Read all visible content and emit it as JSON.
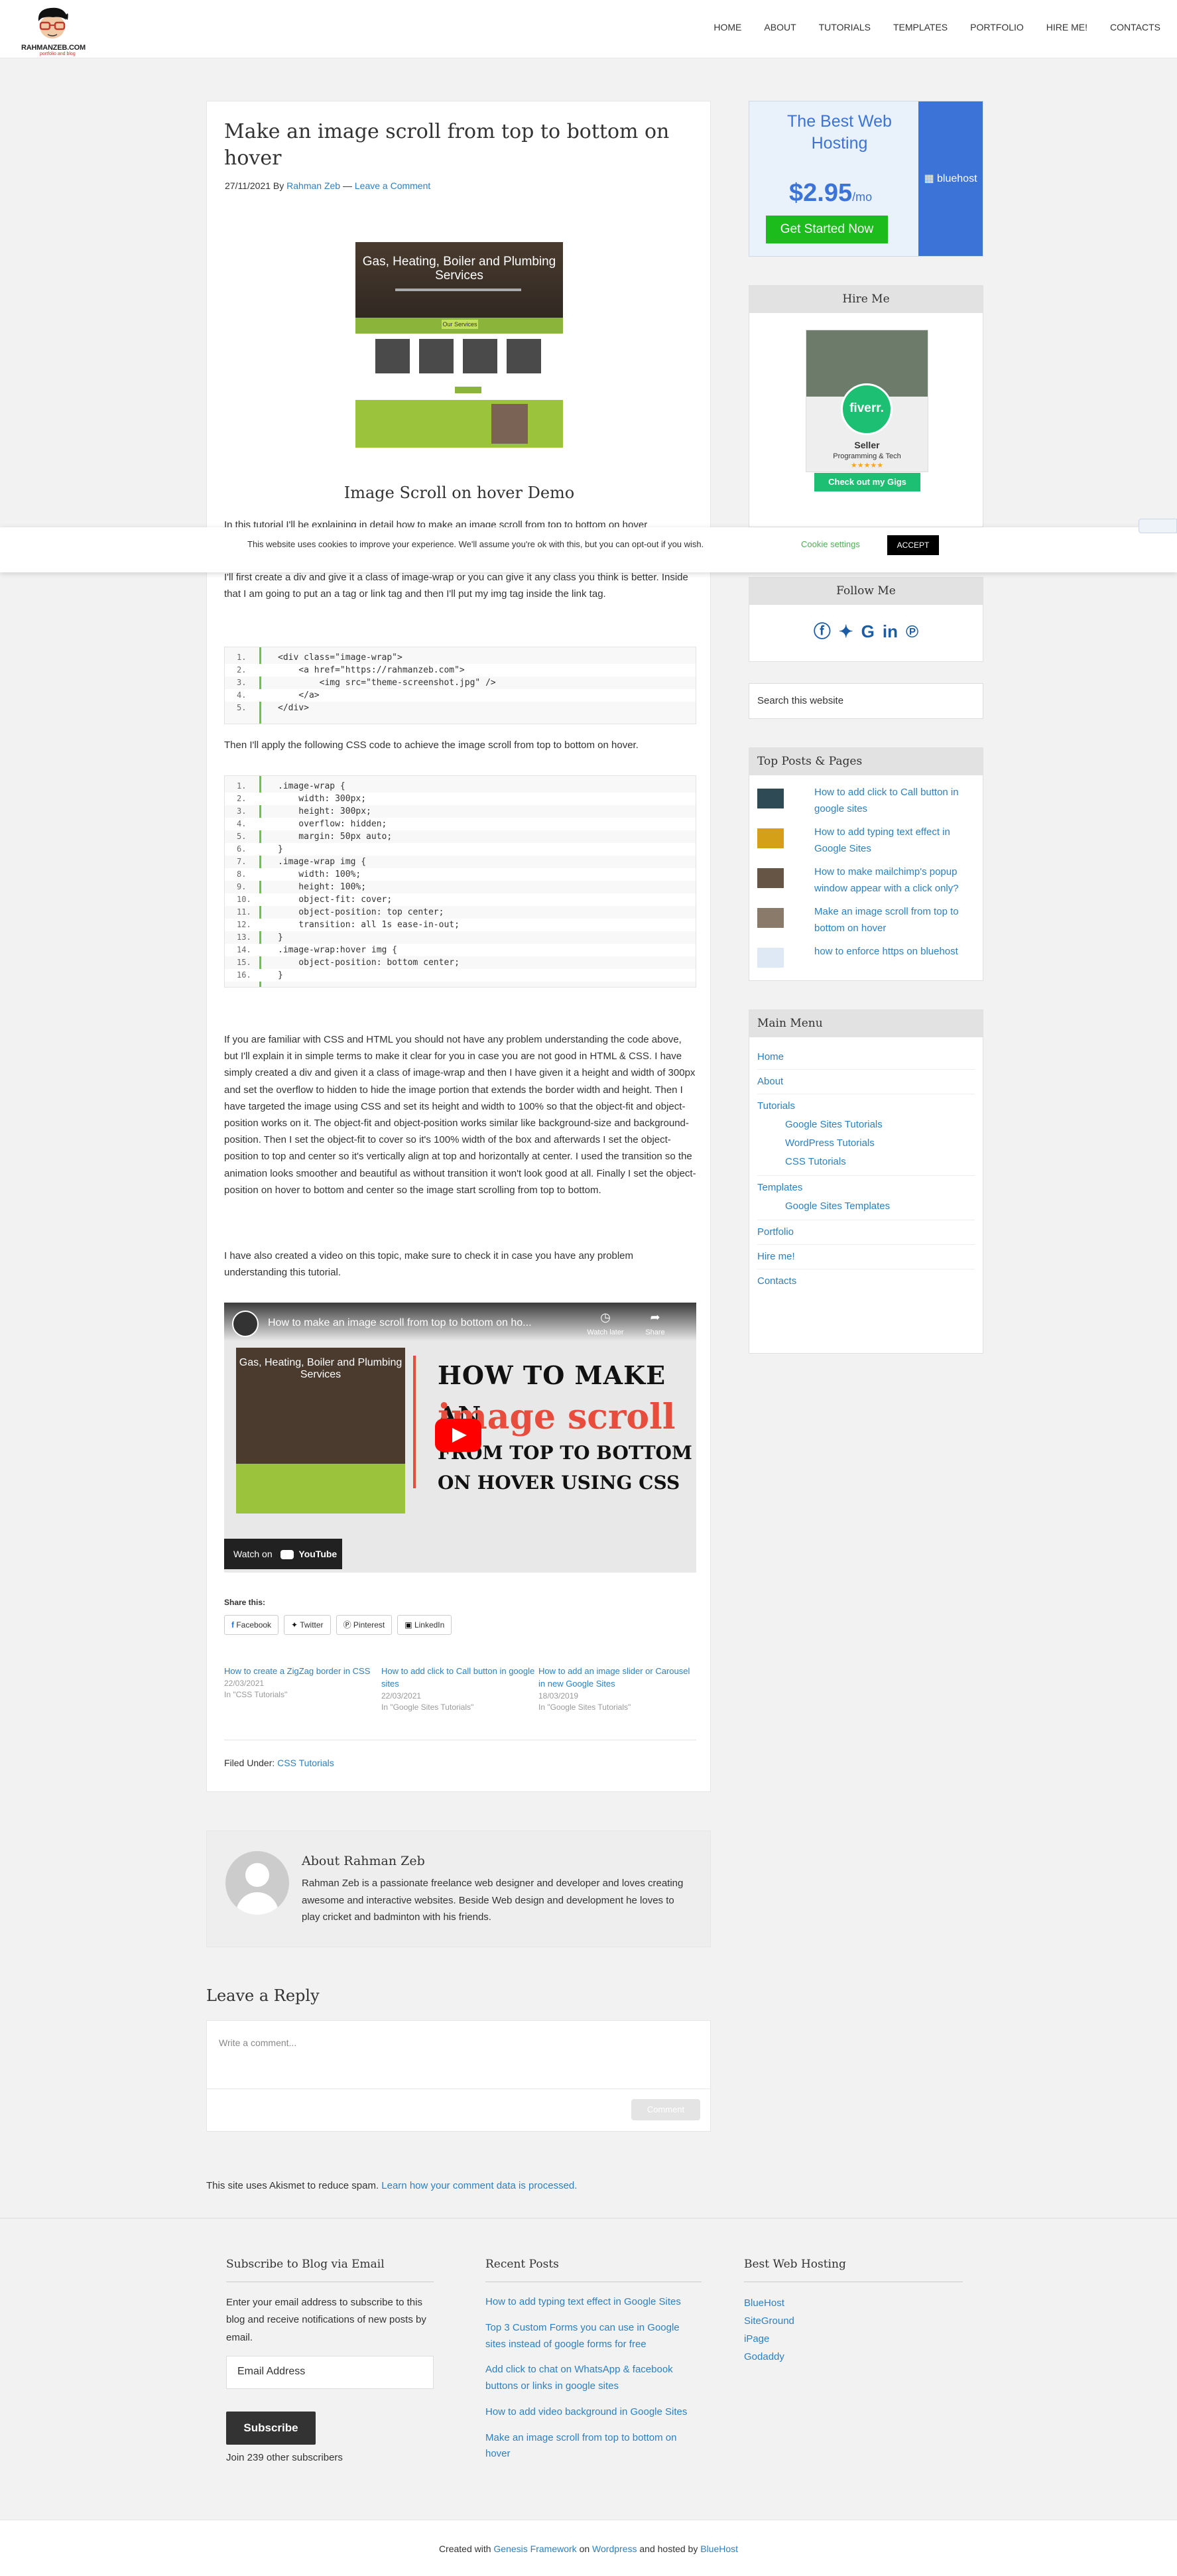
{
  "header": {
    "logo_text": "RAHMANZEB.COM",
    "logo_sub": "portfolio and blog",
    "nav": [
      "HOME",
      "ABOUT",
      "TUTORIALS",
      "TEMPLATES",
      "PORTFOLIO",
      "HIRE ME!",
      "CONTACTS"
    ]
  },
  "article": {
    "title": "Make an image scroll from top to bottom on hover",
    "date": "27/11/2021",
    "by": "By",
    "author": "Rahman Zeb",
    "dash": "—",
    "comment_link": "Leave a Comment",
    "thumb_title": "Gas, Heating, Boiler and Plumbing Services",
    "thumb_btn": "Our Services",
    "demo_title": "Image Scroll on hover Demo",
    "intro": "In this tutorial I'll be explaining in detail how to make an image scroll from top to bottom on hover",
    "p1": "I'll first create a div and give it a class of image-wrap or you can give it any class you think is better. Inside that I am going to put an a tag or link tag and then I'll put my img tag inside the link tag.",
    "code1": [
      {
        "n": "1.",
        "c": "<div class=\"image-wrap\">"
      },
      {
        "n": "2.",
        "c": "    <a href=\"https://rahmanzeb.com\">"
      },
      {
        "n": "3.",
        "c": "        <img src=\"theme-screenshot.jpg\" />"
      },
      {
        "n": "4.",
        "c": "    </a>"
      },
      {
        "n": "5.",
        "c": "</div>"
      }
    ],
    "p2": "Then I'll apply the following CSS code to achieve the image scroll from top to bottom on hover.",
    "code2": [
      {
        "n": "1.",
        "c": ".image-wrap {"
      },
      {
        "n": "2.",
        "c": "    width: 300px;"
      },
      {
        "n": "3.",
        "c": "    height: 300px;"
      },
      {
        "n": "4.",
        "c": "    overflow: hidden;"
      },
      {
        "n": "5.",
        "c": "    margin: 50px auto;"
      },
      {
        "n": "6.",
        "c": "}"
      },
      {
        "n": "7.",
        "c": ".image-wrap img {"
      },
      {
        "n": "8.",
        "c": "    width: 100%;"
      },
      {
        "n": "9.",
        "c": "    height: 100%;"
      },
      {
        "n": "10.",
        "c": "    object-fit: cover;"
      },
      {
        "n": "11.",
        "c": "    object-position: top center;"
      },
      {
        "n": "12.",
        "c": "    transition: all 1s ease-in-out;"
      },
      {
        "n": "13.",
        "c": "}"
      },
      {
        "n": "14.",
        "c": ".image-wrap:hover img {"
      },
      {
        "n": "15.",
        "c": "    object-position: bottom center;"
      },
      {
        "n": "16.",
        "c": "}"
      }
    ],
    "p3": "If you are familiar with CSS and HTML you should not have any problem understanding the code above, but I'll explain it in simple terms to make it clear for you in case you are not good in HTML & CSS. I have simply created a div and given it a class of image-wrap and then I have given it a height and width of 300px and set the overflow to hidden to hide the image portion that extends the border width and height. Then I have targeted the image using CSS and set its height and width to 100% so that the object-fit and object-position works on it. The object-fit and object-position works similar like background-size and background-position. Then I set the object-fit to cover so it's 100% width of the box and afterwards I set the object-position to top and center so it's vertically align at top and horizontally at center. I used the transition so the animation looks smoother and beautiful as without transition it won't look good at all. Finally I set the object-position on hover to bottom and center so the image start scrolling from top to bottom.",
    "p4": "I have also created a video on this topic, make sure to check it in case you have any problem understanding this tutorial.",
    "video": {
      "title": "How to make an image scroll from top to bottom on ho...",
      "watch_later": "Watch later",
      "share": "Share",
      "line1": "HOW TO MAKE AN",
      "line2": "image scroll",
      "line3": "FROM TOP TO BOTTOM",
      "line4": "ON HOVER USING CSS",
      "img_title": "Gas, Heating, Boiler and Plumbing Services",
      "watch_on": "Watch on",
      "yt": "YouTube"
    },
    "share_label": "Share this:",
    "share_buttons": [
      "Facebook",
      "Twitter",
      "Pinterest",
      "LinkedIn"
    ],
    "related": [
      {
        "title": "How to create a ZigZag border in CSS",
        "date": "22/03/2021",
        "cat": "In \"CSS Tutorials\""
      },
      {
        "title": "How to add click to Call button in google sites",
        "date": "22/03/2021",
        "cat": "In \"Google Sites Tutorials\""
      },
      {
        "title": "How to add an image slider or Carousel in new Google Sites",
        "date": "18/03/2019",
        "cat": "In \"Google Sites Tutorials\""
      }
    ],
    "filed_label": "Filed Under:",
    "filed_cat": "CSS Tutorials"
  },
  "author_box": {
    "title": "About Rahman Zeb",
    "desc": "Rahman Zeb is a passionate freelance web designer and developer and loves creating awesome and interactive websites. Beside Web design and development he loves to play cricket and badminton with his friends."
  },
  "reply": {
    "heading": "Leave a Reply",
    "placeholder": "Write a comment...",
    "button": "Comment"
  },
  "akismet": {
    "text": "This site uses Akismet to reduce spam.",
    "link": "Learn how your comment data is processed."
  },
  "sidebar": {
    "ad": {
      "headline": "The Best Web Hosting",
      "price": "$2.95",
      "per": "/mo",
      "button": "Get Started Now",
      "brand": "bluehost"
    },
    "hire": {
      "title": "Hire Me",
      "badge": "fiverr.",
      "seller": "Seller",
      "prog": "Programming & Tech",
      "stars": "★★★★★",
      "gigs": "Check out my Gigs"
    },
    "follow": {
      "title": "Follow Me",
      "icons": [
        "facebook-icon",
        "twitter-icon",
        "google-icon",
        "linkedin-icon",
        "pinterest-icon"
      ]
    },
    "search_placeholder": "Search this website",
    "top_posts": {
      "title": "Top Posts & Pages",
      "items": [
        "How to add click to Call button in google sites",
        "How to add typing text effect in Google Sites",
        "How to make mailchimp's popup window appear with a click only?",
        "Make an image scroll from top to bottom on hover",
        "how to enforce https on bluehost"
      ]
    },
    "menu": {
      "title": "Main Menu",
      "home": "Home",
      "about": "About",
      "tutorials": "Tutorials",
      "tut_sub": [
        "Google Sites Tutorials",
        "WordPress Tutorials",
        "CSS Tutorials"
      ],
      "templates": "Templates",
      "tmpl_sub": [
        "Google Sites Templates"
      ],
      "portfolio": "Portfolio",
      "hire": "Hire me!",
      "contacts": "Contacts"
    }
  },
  "cookie": {
    "text": "This website uses cookies to improve your experience. We'll assume you're ok with this, but you can opt-out if you wish.",
    "settings": "Cookie settings",
    "accept": "ACCEPT"
  },
  "footer": {
    "subscribe": {
      "title": "Subscribe to Blog via Email",
      "desc": "Enter your email address to subscribe to this blog and receive notifications of new posts by email.",
      "email_placeholder": "Email Address",
      "button": "Subscribe",
      "count": "Join 239 other subscribers"
    },
    "recent": {
      "title": "Recent Posts",
      "items": [
        "How to add typing text effect in Google Sites",
        "Top 3 Custom Forms you can use in Google sites instead of google forms for free",
        "Add click to chat on WhatsApp & facebook buttons or links in google sites",
        "How to add video background in Google Sites",
        "Make an image scroll from top to bottom on hover"
      ]
    },
    "hosting": {
      "title": "Best Web Hosting",
      "items": [
        "BlueHost",
        "SiteGround",
        "iPage",
        "Godaddy"
      ]
    }
  },
  "credits": {
    "pre": "Created with",
    "genesis": "Genesis Framework",
    "on": "on",
    "wp": "Wordpress",
    "hosted": "and hosted by",
    "bh": "BlueHost"
  }
}
